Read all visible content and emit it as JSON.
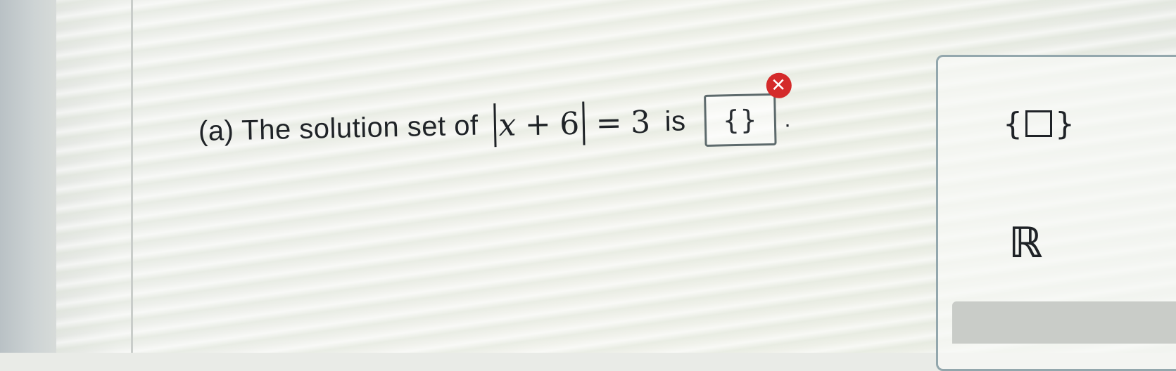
{
  "question": {
    "label": "(a) The solution set of",
    "abs_expr": {
      "var": "x",
      "op": "+",
      "const": "6"
    },
    "equals": "=",
    "rhs": "3",
    "is_word": "is",
    "answer_value": "{}",
    "period": ".",
    "error_icon": "close-icon"
  },
  "keypad": {
    "set_key_left": "{",
    "set_key_right": "}",
    "reals_key": "ℝ"
  },
  "colors": {
    "error": "#d42a2a",
    "box_border": "#5d6a6c",
    "keypad_border": "#93a7ad"
  }
}
